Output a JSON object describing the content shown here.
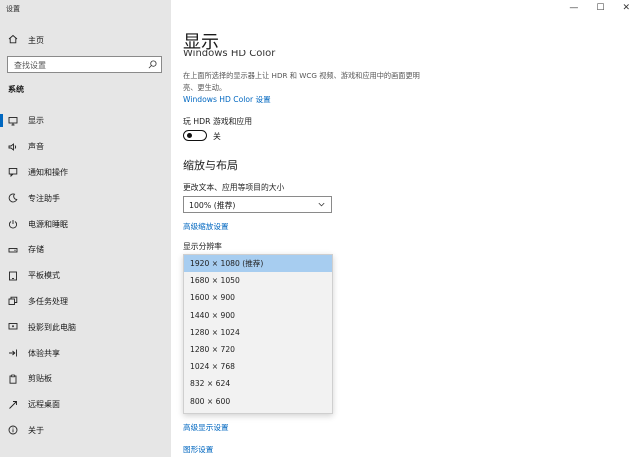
{
  "window": {
    "title": "设置",
    "controls": [
      "—",
      "☐",
      "✕"
    ]
  },
  "sidebar": {
    "home_label": "主页",
    "search_placeholder": "查找设置",
    "section_label": "系统",
    "items": [
      {
        "label": "显示",
        "icon": "monitor-icon",
        "active": true
      },
      {
        "label": "声音",
        "icon": "speaker-icon"
      },
      {
        "label": "通知和操作",
        "icon": "notification-icon"
      },
      {
        "label": "专注助手",
        "icon": "moon-icon"
      },
      {
        "label": "电源和睡眠",
        "icon": "power-icon"
      },
      {
        "label": "存储",
        "icon": "storage-icon"
      },
      {
        "label": "平板模式",
        "icon": "tablet-icon"
      },
      {
        "label": "多任务处理",
        "icon": "multitask-icon"
      },
      {
        "label": "投影到此电脑",
        "icon": "projector-icon"
      },
      {
        "label": "体验共享",
        "icon": "share-icon"
      },
      {
        "label": "剪贴板",
        "icon": "clipboard-icon"
      },
      {
        "label": "远程桌面",
        "icon": "remote-icon"
      },
      {
        "label": "关于",
        "icon": "info-icon"
      }
    ]
  },
  "main": {
    "title": "显示",
    "cut_heading": "Windows HD Color",
    "hd_desc": "在上面所选择的显示器上让 HDR 和 WCG 视频、游戏和应用中的画面更明亮、更生动。",
    "hd_link": "Windows HD Color 设置",
    "hdr_label": "玩 HDR 游戏和应用",
    "hdr_state": "关",
    "scale_heading": "缩放与布局",
    "scale_label": "更改文本、应用等项目的大小",
    "scale_value": "100% (推荐)",
    "adv_scale_link": "高级缩放设置",
    "resolution_label": "显示分辨率",
    "resolution_options": [
      "1920 × 1080 (推荐)",
      "1680 × 1050",
      "1600 × 900",
      "1440 × 900",
      "1280 × 1024",
      "1280 × 720",
      "1024 × 768",
      "832 × 624",
      "800 × 600"
    ],
    "adv_display_link": "高级显示设置",
    "graphics_link": "图形设置"
  }
}
